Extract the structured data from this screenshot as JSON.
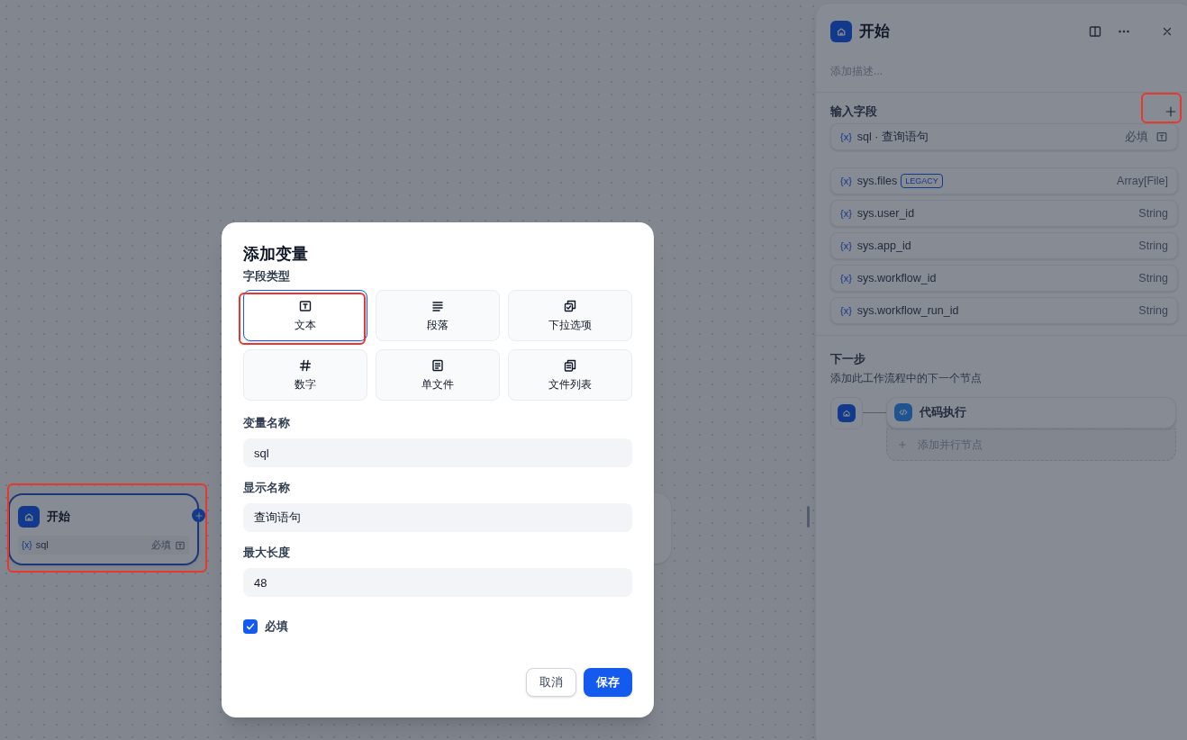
{
  "canvas": {
    "start_node": {
      "title": "开始",
      "highlighted": true,
      "fields": [
        {
          "prefix": "{x}",
          "name": "sql",
          "required": "必填"
        }
      ]
    }
  },
  "panel": {
    "title": "开始",
    "description_placeholder": "添加描述...",
    "input_section": {
      "title": "输入字段",
      "add_highlighted": true
    },
    "fields": [
      {
        "kind": "user",
        "prefix": "{x}",
        "name": "sql · 查询语句",
        "required": "必填"
      },
      {
        "kind": "system",
        "prefix": "{x}",
        "name": "sys.files",
        "badge": "LEGACY",
        "type": "Array[File]"
      },
      {
        "kind": "system",
        "prefix": "{x}",
        "name": "sys.user_id",
        "type": "String"
      },
      {
        "kind": "system",
        "prefix": "{x}",
        "name": "sys.app_id",
        "type": "String"
      },
      {
        "kind": "system",
        "prefix": "{x}",
        "name": "sys.workflow_id",
        "type": "String"
      },
      {
        "kind": "system",
        "prefix": "{x}",
        "name": "sys.workflow_run_id",
        "type": "String"
      }
    ],
    "next_step": {
      "title": "下一步",
      "hint": "添加此工作流程中的下一个节点",
      "next_node": "代码执行",
      "add_parallel": "添加并行节点"
    }
  },
  "dialog": {
    "title": "添加变量",
    "type_label": "字段类型",
    "types": [
      {
        "kind": "text",
        "label": "文本",
        "selected": true,
        "highlighted": true
      },
      {
        "kind": "paragraph",
        "label": "段落",
        "selected": false,
        "highlighted": false
      },
      {
        "kind": "select",
        "label": "下拉选项",
        "selected": false,
        "highlighted": false
      },
      {
        "kind": "number",
        "label": "数字",
        "selected": false,
        "highlighted": false
      },
      {
        "kind": "file",
        "label": "单文件",
        "selected": false,
        "highlighted": false
      },
      {
        "kind": "file_list",
        "label": "文件列表",
        "selected": false,
        "highlighted": false
      }
    ],
    "fields": [
      {
        "label": "变量名称",
        "value": "sql"
      },
      {
        "label": "显示名称",
        "value": "查询语句"
      },
      {
        "label": "最大长度",
        "value": "48"
      }
    ],
    "required": {
      "label": "必填",
      "checked": true
    },
    "buttons": {
      "cancel": "取消",
      "save": "保存"
    }
  }
}
